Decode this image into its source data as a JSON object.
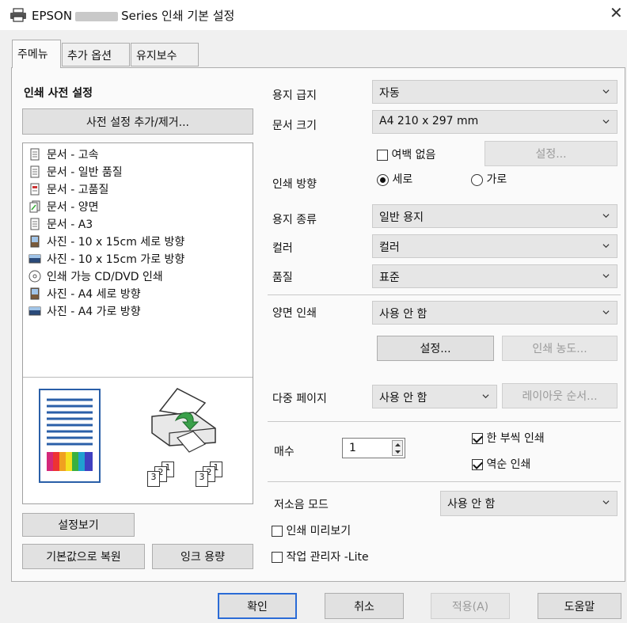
{
  "window": {
    "title_prefix": "EPSON",
    "title_suffix": "Series 인쇄 기본 설정",
    "close_label": "✕"
  },
  "tabs": [
    {
      "label": "주메뉴",
      "active": true
    },
    {
      "label": "추가 옵션",
      "active": false
    },
    {
      "label": "유지보수",
      "active": false
    }
  ],
  "presets": {
    "heading": "인쇄 사전 설정",
    "add_remove_button": "사전 설정 추가/제거...",
    "items": [
      {
        "label": "문서 - 고속",
        "icon": "document-icon"
      },
      {
        "label": "문서 - 일반 품질",
        "icon": "document-icon"
      },
      {
        "label": "문서 - 고품질",
        "icon": "document-color-icon"
      },
      {
        "label": "문서 - 양면",
        "icon": "duplex-document-icon"
      },
      {
        "label": "문서 - A3",
        "icon": "document-icon"
      },
      {
        "label": "사진 - 10 x 15cm 세로 방향",
        "icon": "photo-portrait-icon"
      },
      {
        "label": "사진 - 10 x 15cm 가로 방향",
        "icon": "photo-landscape-icon"
      },
      {
        "label": "인쇄 가능 CD/DVD 인쇄",
        "icon": "disc-icon"
      },
      {
        "label": "사진 - A4 세로 방향",
        "icon": "photo-portrait-icon"
      },
      {
        "label": "사진 - A4 가로 방향",
        "icon": "photo-landscape-icon"
      }
    ],
    "page_numbers": [
      "3",
      "2",
      "1",
      "3",
      "2",
      "1"
    ]
  },
  "left_buttons": {
    "show_settings": "설정보기",
    "restore_defaults": "기본값으로 복원",
    "ink_levels": "잉크 용량"
  },
  "settings": {
    "paper_source": {
      "label": "용지 급지",
      "value": "자동"
    },
    "document_size": {
      "label": "문서 크기",
      "value": "A4 210 x 297 mm"
    },
    "borderless": {
      "label": "여백 없음",
      "checked": false,
      "settings_button": "설정..."
    },
    "orientation": {
      "label": "인쇄 방향",
      "portrait": "세로",
      "landscape": "가로",
      "selected": "세로"
    },
    "paper_type": {
      "label": "용지 종류",
      "value": "일반 용지"
    },
    "color": {
      "label": "컬러",
      "value": "컬러"
    },
    "quality": {
      "label": "품질",
      "value": "표준"
    },
    "duplex": {
      "label": "양면 인쇄",
      "value": "사용 안 함",
      "settings_button": "설정...",
      "density_button": "인쇄 농도..."
    },
    "multi_page": {
      "label": "다중 페이지",
      "value": "사용 안 함",
      "layout_order_button": "레이아웃 순서..."
    },
    "copies": {
      "label": "매수",
      "value": "1",
      "collate": "한 부씩 인쇄",
      "collate_checked": true,
      "reverse": "역순 인쇄",
      "reverse_checked": true
    },
    "quiet_mode": {
      "label": "저소음 모드",
      "value": "사용 안 함"
    },
    "print_preview": {
      "label": "인쇄 미리보기",
      "checked": false
    },
    "job_arranger": {
      "label": "작업 관리자 -Lite",
      "checked": false
    }
  },
  "footer": {
    "ok": "확인",
    "cancel": "취소",
    "apply": "적용(A)",
    "help": "도움말"
  }
}
